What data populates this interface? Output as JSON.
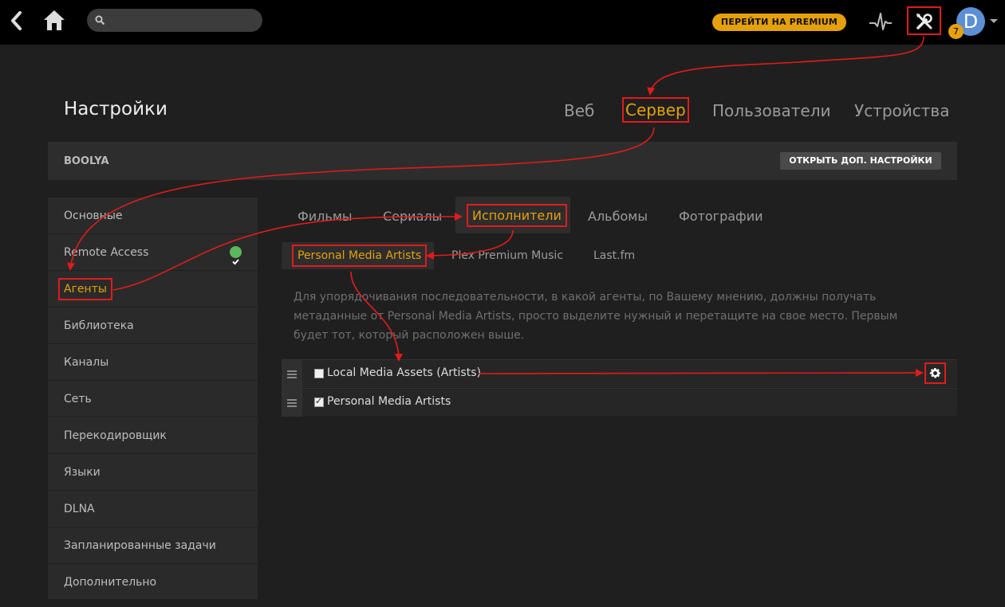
{
  "topbar": {
    "premium_label": "ПЕРЕЙТИ НА PREMIUM",
    "avatar_letter": "D",
    "notification_count": "7"
  },
  "settings": {
    "title": "Настройки",
    "tabs": [
      "Веб",
      "Сервер",
      "Пользователи",
      "Устройства"
    ],
    "active_tab": "Сервер"
  },
  "server": {
    "name": "BOOLYA",
    "advanced_button": "ОТКРЫТЬ ДОП. НАСТРОЙКИ"
  },
  "sidebar": {
    "items": [
      "Основные",
      "Remote Access",
      "Агенты",
      "Библиотека",
      "Каналы",
      "Сеть",
      "Перекодировщик",
      "Языки",
      "DLNA",
      "Запланированные задачи",
      "Дополнительно"
    ],
    "active": "Агенты"
  },
  "media_tabs": {
    "items": [
      "Фильмы",
      "Сериалы",
      "Исполнители",
      "Альбомы",
      "Фотографии"
    ],
    "active": "Исполнители"
  },
  "agent_tabs": {
    "items": [
      "Personal Media Artists",
      "Plex Premium Music",
      "Last.fm"
    ],
    "active": "Personal Media Artists"
  },
  "description": "Для упорядочивания последовательности, в какой агенты, по Вашему мнению, должны получать метаданные от Personal Media Artists, просто выделите нужный и перетащите на свое место. Первым будет тот, который расположен выше.",
  "agents": [
    {
      "name": "Local Media Assets (Artists)",
      "checked": false
    },
    {
      "name": "Personal Media Artists",
      "checked": true
    }
  ],
  "colors": {
    "accent": "#e5a00d",
    "highlight": "#e21b1b",
    "avatar": "#5c8fd3",
    "success": "#5cb85c"
  }
}
